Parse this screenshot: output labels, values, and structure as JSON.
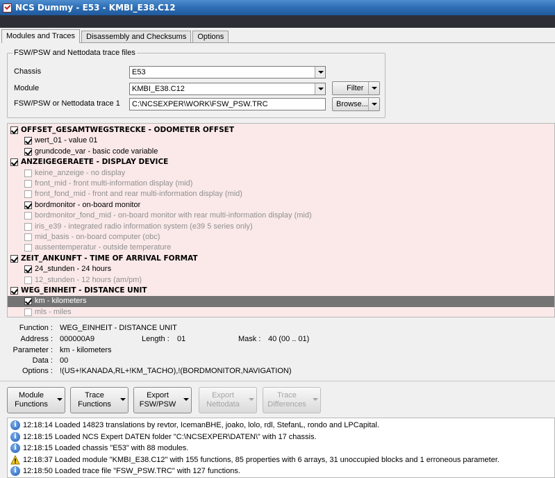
{
  "window": {
    "title": "NCS Dummy - E53 - KMBI_E38.C12"
  },
  "tabs": [
    "Modules and Traces",
    "Disassembly and Checksums",
    "Options"
  ],
  "files_group": {
    "title": "FSW/PSW and Nettodata trace files",
    "chassis_label": "Chassis",
    "chassis_value": "E53",
    "module_label": "Module",
    "module_value": "KMBI_E38.C12",
    "trace_label": "FSW/PSW or Nettodata trace 1",
    "trace_value": "C:\\NCSEXPER\\WORK\\FSW_PSW.TRC",
    "filter_button": "Filter",
    "browse_button": "Browse..."
  },
  "tree": [
    {
      "level": 0,
      "checked": true,
      "dim": false,
      "selected": false,
      "text": "OFFSET_GESAMTWEGSTRECKE  -  ODOMETER OFFSET"
    },
    {
      "level": 1,
      "checked": true,
      "dim": false,
      "selected": false,
      "text": "wert_01  -  value 01"
    },
    {
      "level": 1,
      "checked": true,
      "dim": false,
      "selected": false,
      "text": "grundcode_var  -  basic code variable"
    },
    {
      "level": 0,
      "checked": true,
      "dim": false,
      "selected": false,
      "text": "ANZEIGEGERAETE  -  DISPLAY DEVICE"
    },
    {
      "level": 1,
      "checked": false,
      "dim": true,
      "selected": false,
      "text": "keine_anzeige  -  no display"
    },
    {
      "level": 1,
      "checked": false,
      "dim": true,
      "selected": false,
      "text": "front_mid  -  front multi-information display (mid)"
    },
    {
      "level": 1,
      "checked": false,
      "dim": true,
      "selected": false,
      "text": "front_fond_mid  -  front and rear multi-information display (mid)"
    },
    {
      "level": 1,
      "checked": true,
      "dim": false,
      "selected": false,
      "text": "bordmonitor  -  on-board monitor"
    },
    {
      "level": 1,
      "checked": false,
      "dim": true,
      "selected": false,
      "text": "bordmonitor_fond_mid  -  on-board monitor with rear multi-information display (mid)"
    },
    {
      "level": 1,
      "checked": false,
      "dim": true,
      "selected": false,
      "text": "iris_e39  -  integrated radio information system (e39 5 series only)"
    },
    {
      "level": 1,
      "checked": false,
      "dim": true,
      "selected": false,
      "text": "mid_basis  -  on-board computer (obc)"
    },
    {
      "level": 1,
      "checked": false,
      "dim": true,
      "selected": false,
      "text": "aussentemperatur  -  outside temperature"
    },
    {
      "level": 0,
      "checked": true,
      "dim": false,
      "selected": false,
      "text": "ZEIT_ANKUNFT  -  TIME OF ARRIVAL FORMAT"
    },
    {
      "level": 1,
      "checked": true,
      "dim": false,
      "selected": false,
      "text": "24_stunden  -  24 hours"
    },
    {
      "level": 1,
      "checked": false,
      "dim": true,
      "selected": false,
      "text": "12_stunden  -  12 hours (am/pm)"
    },
    {
      "level": 0,
      "checked": true,
      "dim": false,
      "selected": false,
      "text": "WEG_EINHEIT  -  DISTANCE UNIT"
    },
    {
      "level": 1,
      "checked": true,
      "dim": false,
      "selected": true,
      "text": "km  -  kilometers"
    },
    {
      "level": 1,
      "checked": false,
      "dim": true,
      "selected": false,
      "text": "mls  -  miles"
    }
  ],
  "details": {
    "function_label": "Function :",
    "function_value": "WEG_EINHEIT  -  DISTANCE UNIT",
    "address_label": "Address :",
    "address_value": "000000A9",
    "length_label": "Length :",
    "length_value": "01",
    "mask_label": "Mask :",
    "mask_value": "40  (00 .. 01)",
    "parameter_label": "Parameter :",
    "parameter_value": "km  -  kilometers",
    "data_label": "Data :",
    "data_value": "00",
    "options_label": "Options :",
    "options_value": "!(US+!KANADA,RL+!KM_TACHO),!(BORDMONITOR,NAVIGATION)"
  },
  "action_buttons": [
    {
      "line1": "Module",
      "line2": "Functions",
      "enabled": true
    },
    {
      "line1": "Trace",
      "line2": "Functions",
      "enabled": true
    },
    {
      "line1": "Export",
      "line2": "FSW/PSW",
      "enabled": true
    },
    {
      "line1": "Export",
      "line2": "Nettodata",
      "enabled": false
    },
    {
      "line1": "Trace",
      "line2": "Differences",
      "enabled": false
    }
  ],
  "log": [
    {
      "icon": "info-icon",
      "text": "12:18:14  Loaded 14823 translations by revtor, IcemanBHE, joako, lolo, rdl, StefanL, rondo and LPCapital."
    },
    {
      "icon": "info-icon",
      "text": "12:18:15  Loaded NCS Expert DATEN folder \"C:\\NCSEXPER\\DATEN\\\" with 17 chassis."
    },
    {
      "icon": "info-icon",
      "text": "12:18:15  Loaded chassis \"E53\" with 88 modules."
    },
    {
      "icon": "warning-icon",
      "text": "12:18:37  Loaded module \"KMBI_E38.C12\" with 155 functions, 85 properties with 6 arrays, 31 unoccupied blocks and 1 erroneous parameter."
    },
    {
      "icon": "info-icon",
      "text": "12:18:50  Loaded trace file \"FSW_PSW.TRC\" with 127 functions."
    }
  ]
}
